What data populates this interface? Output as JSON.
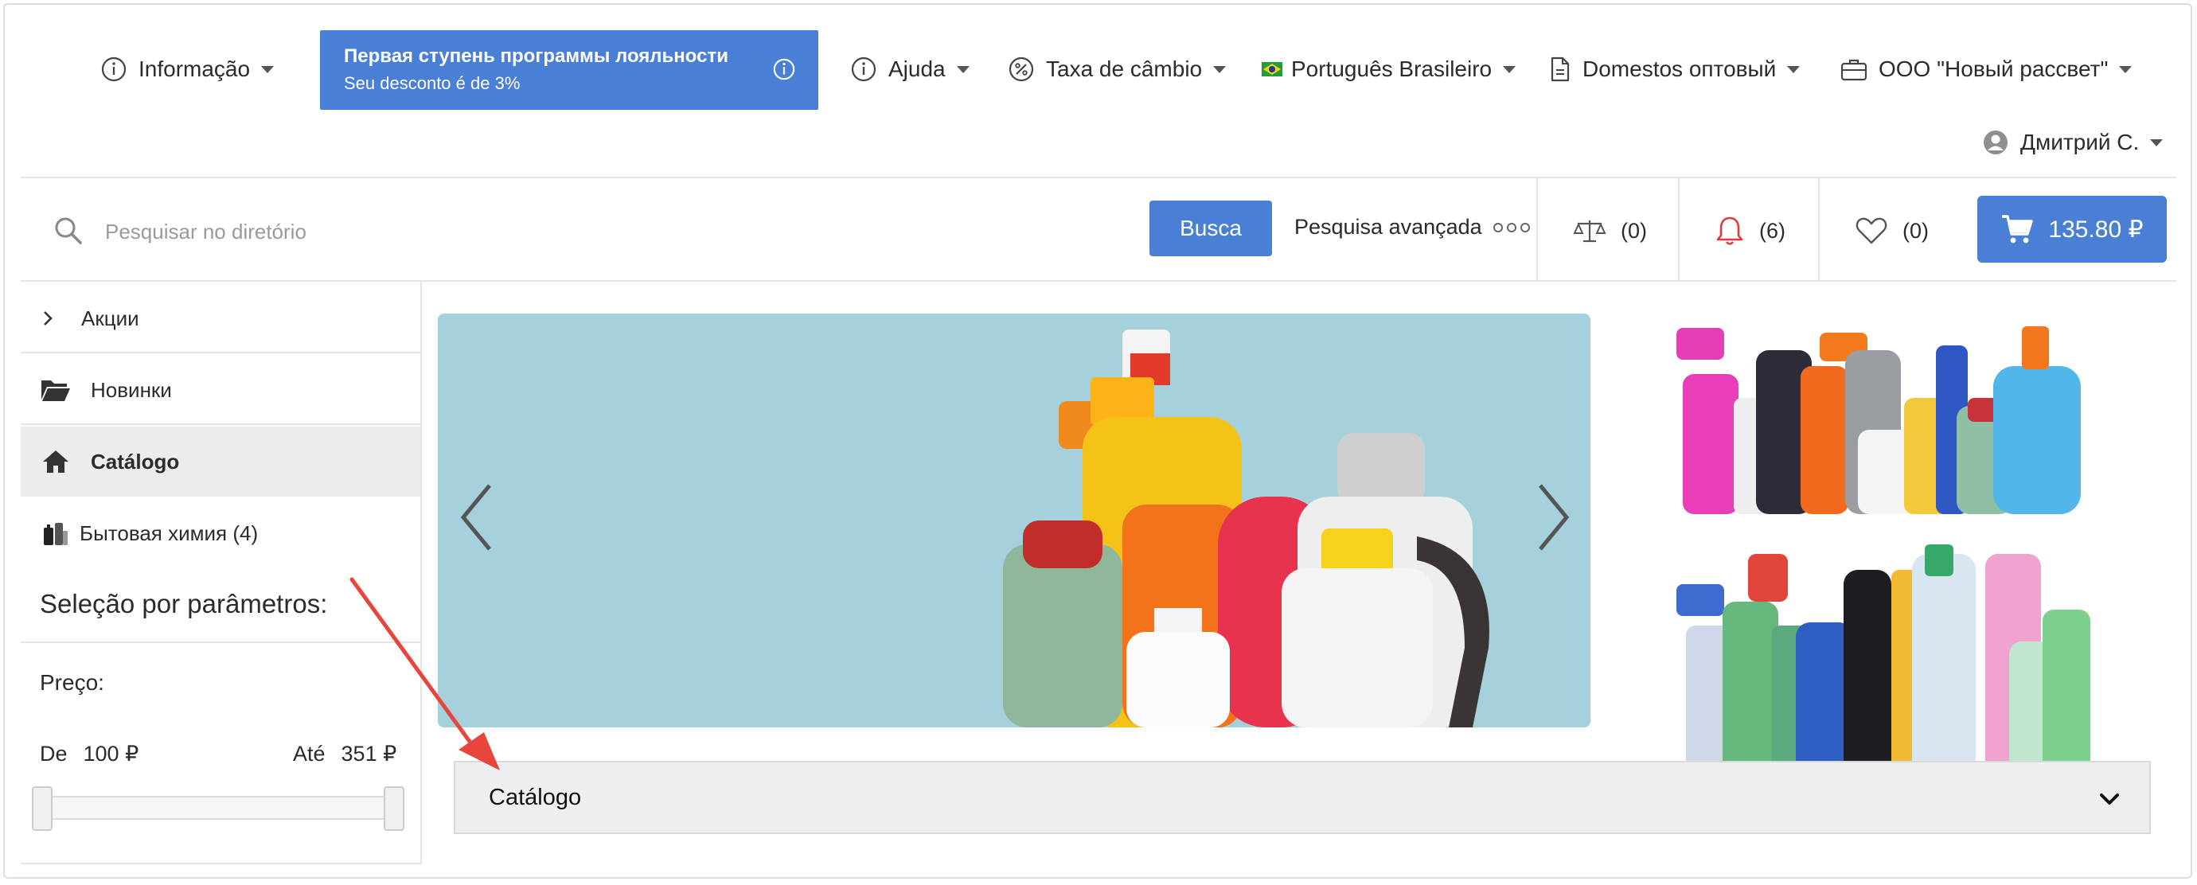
{
  "header": {
    "nav": [
      {
        "label": "Informação",
        "icon": "info-icon"
      },
      {
        "label": "Ajuda",
        "icon": "info-icon"
      },
      {
        "label": "Taxa de câmbio",
        "icon": "percent-icon"
      },
      {
        "label": "Português Brasileiro",
        "icon": "brazil-flag-icon"
      },
      {
        "label": "Domestos оптовый",
        "icon": "document-icon"
      },
      {
        "label": "ООО \"Новый рассвет\"",
        "icon": "briefcase-icon"
      },
      {
        "label": "Дмитрий С.",
        "icon": "user-avatar-icon"
      }
    ],
    "loyalty": {
      "title": "Первая ступень программы лояльности",
      "subtitle": "Seu desconto é de 3%"
    }
  },
  "search": {
    "placeholder": "Pesquisar no diretório",
    "button_label": "Busca",
    "advanced_label": "Pesquisa avançada"
  },
  "counters": {
    "compare": "(0)",
    "notifications": "(6)",
    "favorites": "(0)"
  },
  "cart": {
    "total": "135.80 ₽"
  },
  "sidebar": {
    "items": [
      {
        "label": "Акции",
        "icon": "chevron-right-icon"
      },
      {
        "label": "Новинки",
        "icon": "folder-open-icon"
      },
      {
        "label": "Catálogo",
        "icon": "home-icon",
        "active": true
      },
      {
        "label": "Бытовая химия (4)",
        "icon": "category-thumbnail-icon"
      }
    ],
    "params_title": "Seleção por parâmetros:",
    "price": {
      "label": "Preço:",
      "from_label": "De",
      "from_value": "100 ₽",
      "to_label": "Até",
      "to_value": "351 ₽"
    }
  },
  "main": {
    "catalog_label": "Catálogo"
  },
  "colors": {
    "accent": "#4a7fd6",
    "notification": "#e0393e",
    "annotation_arrow": "#e8453c",
    "banner_bg": "#a9d3df"
  }
}
